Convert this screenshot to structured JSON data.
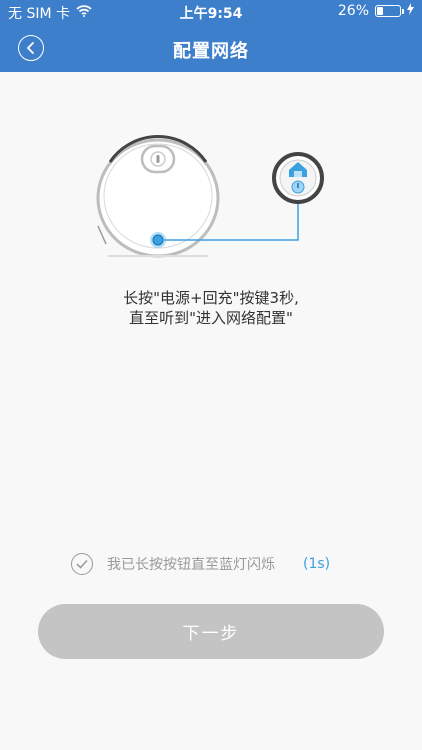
{
  "status_bar": {
    "carrier": "无 SIM 卡",
    "time": "上午9:54",
    "battery_percent": "26%",
    "battery_level": 0.26,
    "wifi_icon": "wifi-icon",
    "charging_icon": "bolt-icon"
  },
  "header": {
    "title": "配置网络",
    "back_icon": "chevron-left-icon"
  },
  "illustration": {
    "robot": "robot-vacuum-icon",
    "remote": "power-button-panel-icon"
  },
  "instruction": {
    "line1": "长按\"电源+回充\"按键3秒,",
    "line2": "直至听到\"进入网络配置\""
  },
  "confirm": {
    "label": "我已长按按钮直至蓝灯闪烁",
    "countdown": "(1s)"
  },
  "next_button": {
    "label": "下一步"
  },
  "colors": {
    "accent": "#3d7fcb",
    "highlight": "#3aa0e0",
    "disabled_button": "#c4c4c4"
  }
}
